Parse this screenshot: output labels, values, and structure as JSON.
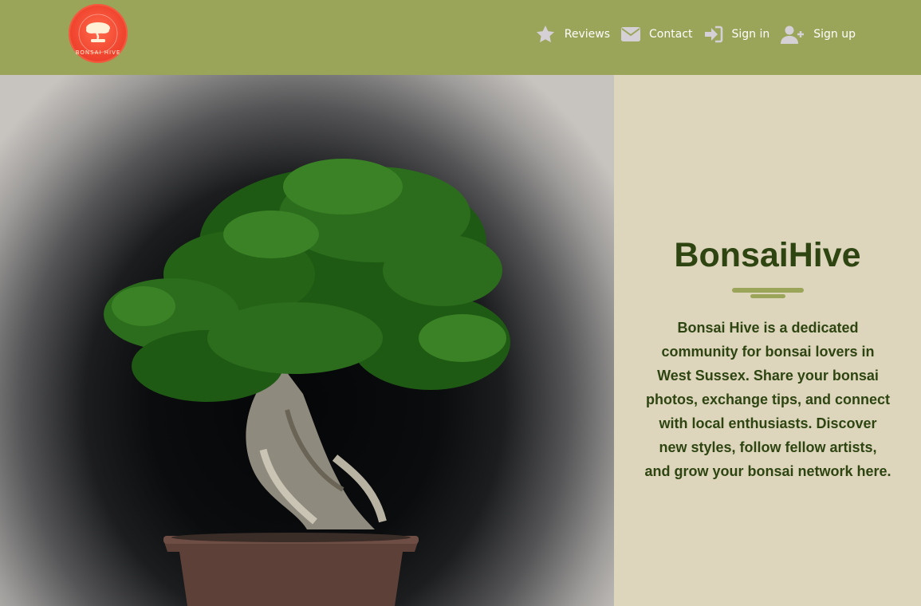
{
  "header": {
    "logo_text": "BONSAI HIVE",
    "colors": {
      "background": "#9ba55a",
      "logo": "#f0442f"
    }
  },
  "nav": {
    "items": [
      {
        "label": "Reviews",
        "icon": "star-icon"
      },
      {
        "label": "Contact",
        "icon": "envelope-icon"
      },
      {
        "label": "Sign in",
        "icon": "sign-in-icon"
      },
      {
        "label": "Sign up",
        "icon": "user-plus-icon"
      }
    ]
  },
  "hero": {
    "image": "bonsai-tree-photo"
  },
  "panel": {
    "title": "BonsaiHive",
    "description": "Bonsai Hive is a dedicated community for bonsai lovers in West Sussex. Share your bonsai photos, exchange tips, and connect with local enthusiasts. Discover new styles, follow fellow artists, and grow your bonsai network here.",
    "colors": {
      "background": "#ddd6bc",
      "text": "#2e4512",
      "accent": "#9ba55a"
    }
  }
}
